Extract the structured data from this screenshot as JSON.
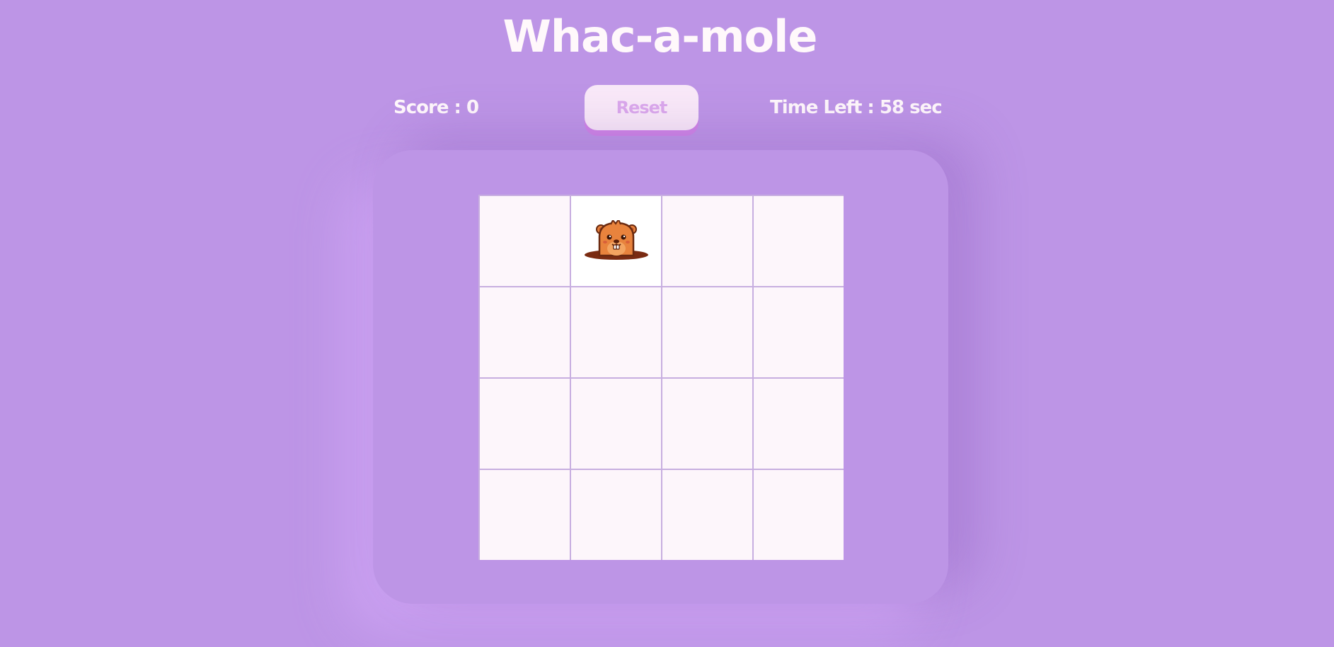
{
  "game": {
    "title": "Whac-a-mole",
    "score_text": "Score : 0",
    "reset_label": "Reset",
    "time_left_text": "Time Left : 58 sec"
  },
  "grid": {
    "rows": 4,
    "cols": 4,
    "mole_position": 1
  },
  "colors": {
    "background": "#bd95e6",
    "cell": "#fdf6fb",
    "button": "#f9e9f8",
    "button_text": "#dba8ec",
    "mole": "#e8833d",
    "hole": "#7a2b12"
  }
}
